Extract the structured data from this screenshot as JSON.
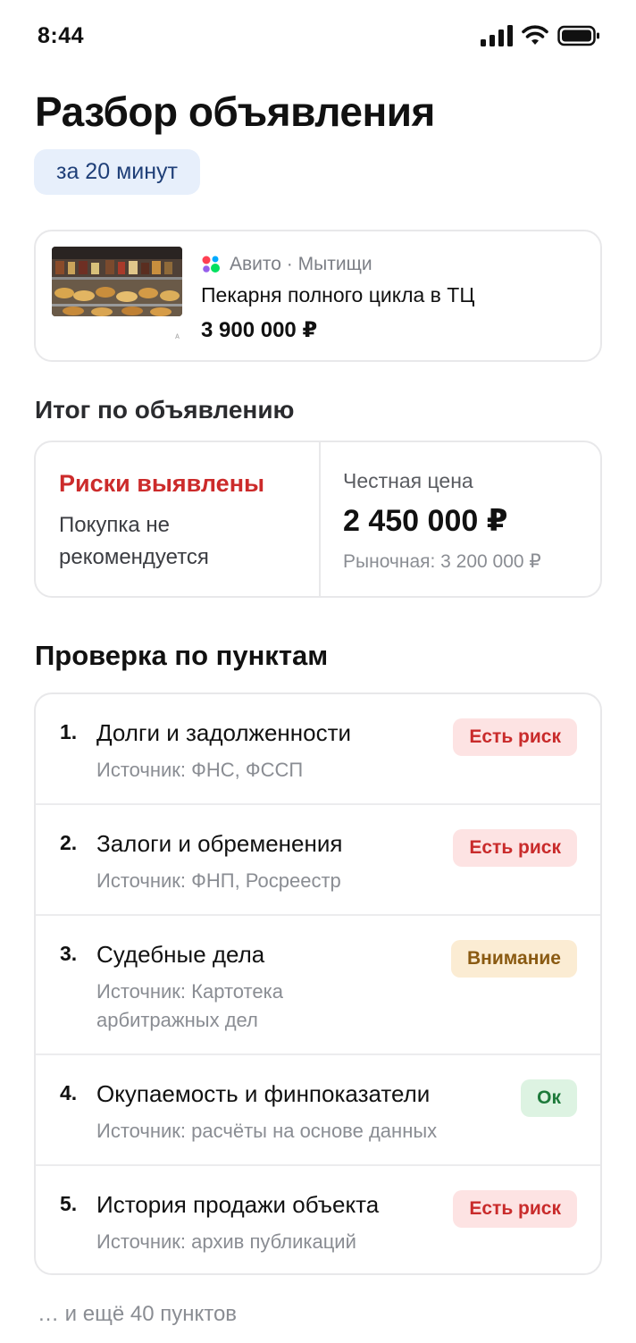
{
  "status_bar": {
    "time": "8:44",
    "icons": [
      "signal-icon",
      "wifi-icon",
      "battery-icon"
    ]
  },
  "header": {
    "title": "Разбор объявления",
    "duration": "за 20 минут"
  },
  "listing": {
    "platform": "Авито",
    "separator": " · ",
    "city": "Мытищи",
    "title": "Пекарня полного цикла в ТЦ",
    "price": "3 900 000 ₽"
  },
  "summary": {
    "heading": "Итог по объявлению",
    "risk_title": "Риски выявлены",
    "risk_description": "Покупка не рекомендуется",
    "fair_price_label": "Честная цена",
    "fair_price": "2 450 000 ₽",
    "market_price": "Рыночная: 3 200 000 ₽"
  },
  "checks": {
    "heading": "Проверка по пунктам",
    "items": [
      {
        "number": "1.",
        "title": "Долги и задолженности",
        "source": "Источник: ФНС, ФССП",
        "status": "Есть риск",
        "status_type": "risk"
      },
      {
        "number": "2.",
        "title": "Залоги и обременения",
        "source": "Источник: ФНП, Росреестр",
        "status": "Есть риск",
        "status_type": "risk"
      },
      {
        "number": "3.",
        "title": "Судебные дела",
        "source": "Источник: Картотека арбитражных дел",
        "status": "Внимание",
        "status_type": "warning"
      },
      {
        "number": "4.",
        "title": "Окупаемость и финпоказатели",
        "source": "Источник: расчёты на основе данных",
        "status": "Ок",
        "status_type": "ok"
      },
      {
        "number": "5.",
        "title": "История продажи объекта",
        "source": "Источник: архив публикаций",
        "status": "Есть риск",
        "status_type": "risk"
      }
    ],
    "more": "… и ещё 40 пунктов"
  },
  "colors": {
    "risk_text": "#cc2b2b",
    "risk_badge_bg": "#fde3e3",
    "warning_badge_bg": "#fbecd3",
    "warning_text": "#8a5a12",
    "ok_badge_bg": "#ddf3e2",
    "ok_text": "#1e7a3b",
    "chip_bg": "#e7effb",
    "chip_text": "#1f3f78"
  }
}
